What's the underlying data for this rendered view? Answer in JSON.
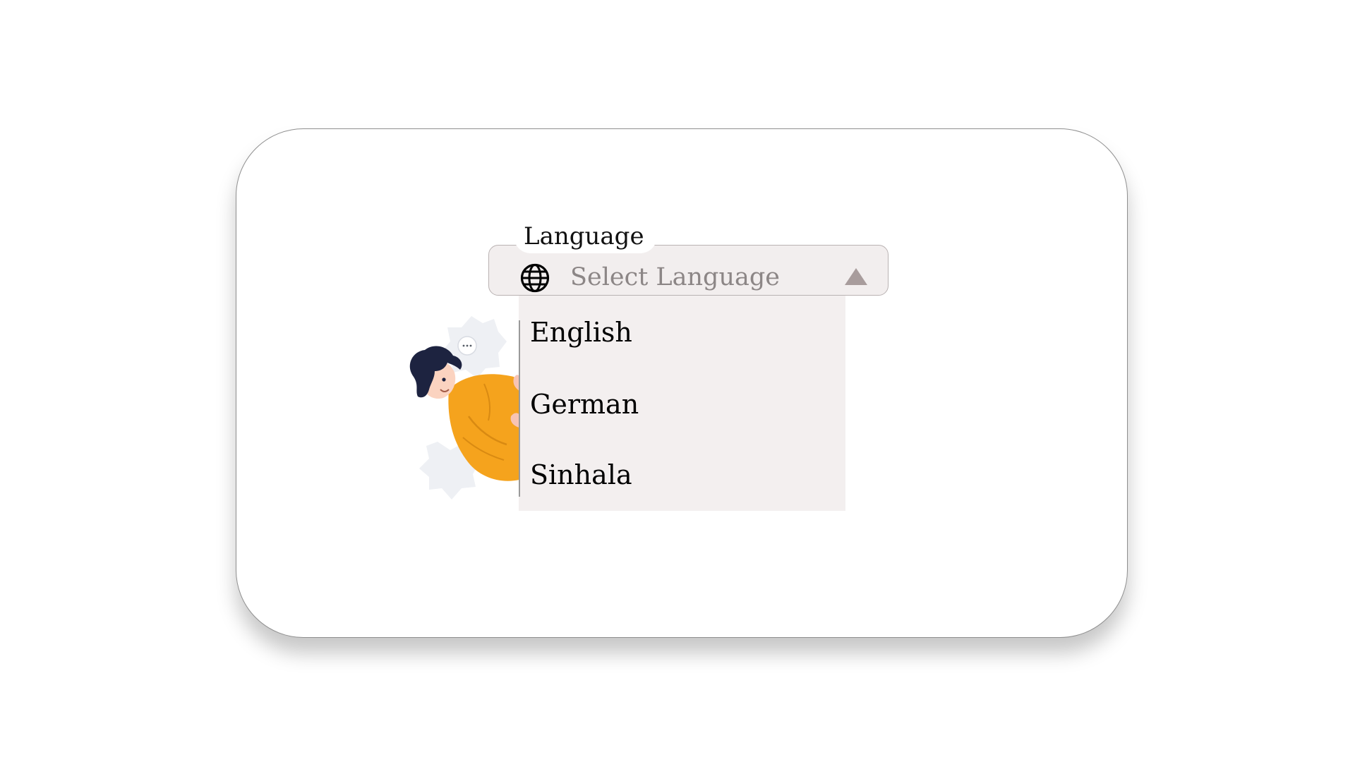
{
  "field": {
    "label": "Language",
    "placeholder": "Select Language"
  },
  "icons": {
    "leading": "globe-icon",
    "trailing": "caret-up-icon"
  },
  "dropdown": {
    "expanded": true,
    "options": [
      "English",
      "German",
      "Sinhala"
    ]
  },
  "colors": {
    "field_background": "#f2eeee",
    "menu_background": "#f3efef",
    "placeholder_text": "#8c8686",
    "caret": "#a89c9c",
    "illustration_shirt": "#f5a31d",
    "illustration_hair": "#1d2340"
  }
}
